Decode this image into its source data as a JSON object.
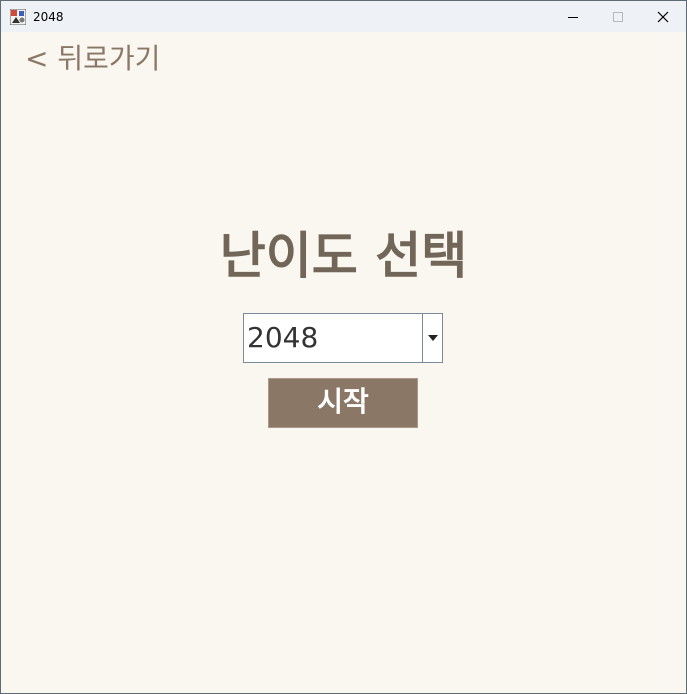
{
  "window": {
    "title": "2048",
    "controls": {
      "minimize_icon": "minimize-icon",
      "maximize_icon": "maximize-icon",
      "close_icon": "close-icon"
    }
  },
  "navigation": {
    "back_label": "< 뒤로가기"
  },
  "main": {
    "heading": "난이도 선택",
    "difficulty_select": {
      "selected_value": "2048"
    },
    "start_label": "시작"
  },
  "colors": {
    "background": "#faf7f0",
    "accent": "#8b7766",
    "heading": "#726659",
    "button_text": "#ffffff"
  }
}
